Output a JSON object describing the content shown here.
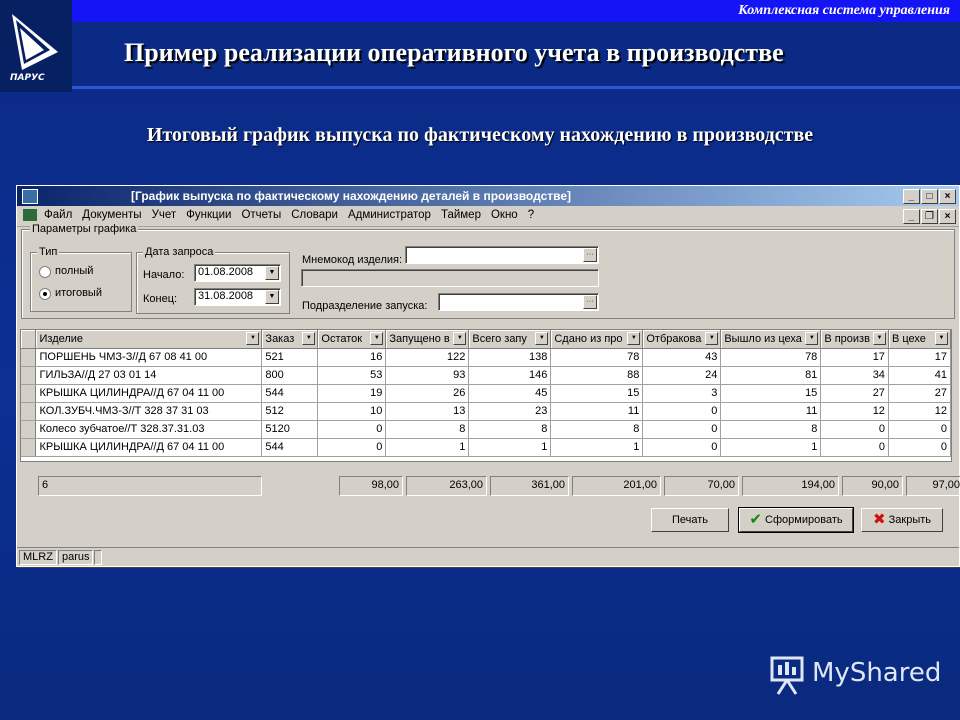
{
  "header": {
    "tagline": "Комплексная система управления",
    "title": "Пример реализации оперативного учета в производстве",
    "subtitle": "Итоговый график выпуска по фактическому нахождению в производстве",
    "logo_text": "ПАРУС"
  },
  "window": {
    "title": "[График выпуска  по фактическому нахождению деталей в производстве]",
    "menu": [
      "Файл",
      "Документы",
      "Учет",
      "Функции",
      "Отчеты",
      "Словари",
      "Администратор",
      "Таймер",
      "Окно",
      "?"
    ]
  },
  "params": {
    "panel_label": "Параметры графика",
    "type_label": "Тип",
    "type_options": [
      "полный",
      "итоговый"
    ],
    "type_selected": "итоговый",
    "date_label": "Дата запроса",
    "start_label": "Начало:",
    "start_value": "01.08.2008",
    "end_label": "Конец:",
    "end_value": "31.08.2008",
    "mnemo_label": "Мнемокод изделия:",
    "mnemo_value": "",
    "dept_label": "Подразделение запуска:",
    "dept_value": ""
  },
  "grid": {
    "columns": [
      "Изделие",
      "Заказ",
      "Остаток",
      "Запущено в",
      "Всего запу",
      "Сдано из про",
      "Отбракова",
      "Вышло из цеха",
      "В произв",
      "В цехе"
    ],
    "rows": [
      [
        "ПОРШЕНЬ ЧМЗ-З//Д 67 08 41 00",
        "521",
        "16",
        "122",
        "138",
        "78",
        "43",
        "78",
        "17",
        "17"
      ],
      [
        "ГИЛЬЗА//Д 27 03 01 14",
        "800",
        "53",
        "93",
        "146",
        "88",
        "24",
        "81",
        "34",
        "41"
      ],
      [
        "КРЫШКА ЦИЛИНДРА//Д 67 04 11 00",
        "544",
        "19",
        "26",
        "45",
        "15",
        "3",
        "15",
        "27",
        "27"
      ],
      [
        "КОЛ.ЗУБЧ.ЧМЗ-З//Т 328 37 31 03",
        "512",
        "10",
        "13",
        "23",
        "11",
        "0",
        "11",
        "12",
        "12"
      ],
      [
        "Колесо зубчатое//Т 328.37.31.03",
        "5120",
        "0",
        "8",
        "8",
        "8",
        "0",
        "8",
        "0",
        "0"
      ],
      [
        "КРЫШКА ЦИЛИНДРА//Д 67 04 11 00",
        "544",
        "0",
        "1",
        "1",
        "1",
        "0",
        "1",
        "0",
        "0"
      ]
    ]
  },
  "totals": {
    "count": "6",
    "values": [
      "98,00",
      "263,00",
      "361,00",
      "201,00",
      "70,00",
      "194,00",
      "90,00",
      "97,00"
    ]
  },
  "buttons": {
    "print": "Печать",
    "build": "Сформировать",
    "close": "Закрыть"
  },
  "status": {
    "db": "MLRZ",
    "user": "parus"
  },
  "brand": {
    "text": "MyShared"
  }
}
